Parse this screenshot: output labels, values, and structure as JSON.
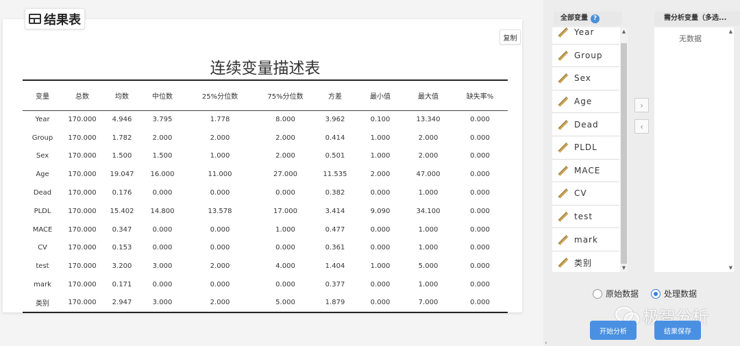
{
  "result": {
    "tab_label": "结果表",
    "copy_label": "复制",
    "title": "连续变量描述表",
    "columns": [
      "变量",
      "总数",
      "均数",
      "中位数",
      "25%分位数",
      "75%分位数",
      "方差",
      "最小值",
      "最大值",
      "缺失率%"
    ],
    "rows": [
      [
        "Year",
        "170.000",
        "4.946",
        "3.795",
        "1.778",
        "8.000",
        "3.962",
        "0.100",
        "13.340",
        "0.000"
      ],
      [
        "Group",
        "170.000",
        "1.782",
        "2.000",
        "2.000",
        "2.000",
        "0.414",
        "1.000",
        "2.000",
        "0.000"
      ],
      [
        "Sex",
        "170.000",
        "1.500",
        "1.500",
        "1.000",
        "2.000",
        "0.501",
        "1.000",
        "2.000",
        "0.000"
      ],
      [
        "Age",
        "170.000",
        "19.047",
        "16.000",
        "11.000",
        "27.000",
        "11.535",
        "2.000",
        "47.000",
        "0.000"
      ],
      [
        "Dead",
        "170.000",
        "0.176",
        "0.000",
        "0.000",
        "0.000",
        "0.382",
        "0.000",
        "1.000",
        "0.000"
      ],
      [
        "PLDL",
        "170.000",
        "15.402",
        "14.800",
        "13.578",
        "17.000",
        "3.414",
        "9.090",
        "34.100",
        "0.000"
      ],
      [
        "MACE",
        "170.000",
        "0.347",
        "0.000",
        "0.000",
        "1.000",
        "0.477",
        "0.000",
        "1.000",
        "0.000"
      ],
      [
        "CV",
        "170.000",
        "0.153",
        "0.000",
        "0.000",
        "0.000",
        "0.361",
        "0.000",
        "1.000",
        "0.000"
      ],
      [
        "test",
        "170.000",
        "3.200",
        "3.000",
        "2.000",
        "4.000",
        "1.404",
        "1.000",
        "5.000",
        "0.000"
      ],
      [
        "mark",
        "170.000",
        "0.171",
        "0.000",
        "0.000",
        "0.000",
        "0.377",
        "0.000",
        "1.000",
        "0.000"
      ],
      [
        "类别",
        "170.000",
        "2.947",
        "3.000",
        "2.000",
        "5.000",
        "1.879",
        "0.000",
        "7.000",
        "0.000"
      ]
    ]
  },
  "panel": {
    "all_vars_label": "全部变量",
    "help_icon_glyph": "?",
    "selected_label": "需分析变量（多选...",
    "variables": [
      "Year",
      "Group",
      "Sex",
      "Age",
      "Dead",
      "PLDL",
      "MACE",
      "CV",
      "test",
      "mark",
      "类别"
    ],
    "no_data_label": "无数据",
    "move_right_glyph": "›",
    "move_left_glyph": "‹",
    "radio_options": [
      {
        "label": "原始数据",
        "checked": false
      },
      {
        "label": "处理数据",
        "checked": true
      }
    ],
    "start_button": "开始分析",
    "save_button": "结果保存",
    "watermark": "极智分析"
  },
  "colors": {
    "accent": "#4a90e2",
    "radio_checked": "#3b7ddd",
    "help_icon": "#4a90d9"
  }
}
